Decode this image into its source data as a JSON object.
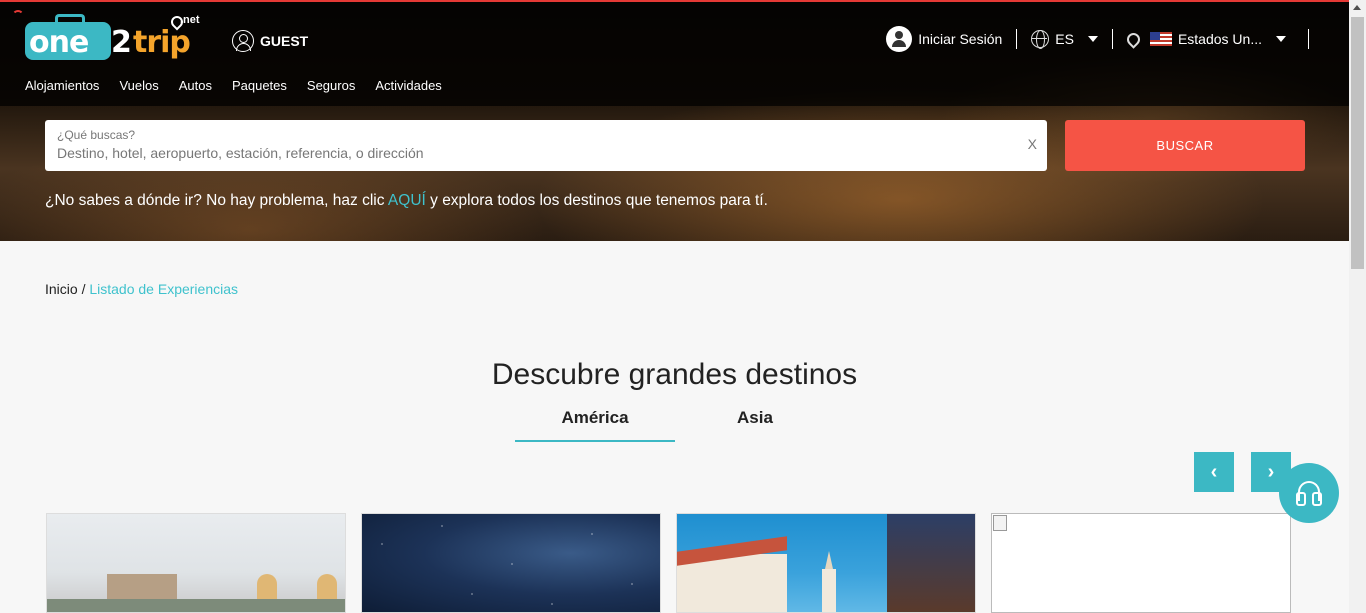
{
  "header": {
    "logo": {
      "one": "one",
      "two": "2",
      "trip": "trip",
      "net": ".net"
    },
    "guest_label": "GUEST",
    "login_label": "Iniciar Sesión",
    "language": "ES",
    "country": "Estados Un..."
  },
  "nav": {
    "items": [
      "Alojamientos",
      "Vuelos",
      "Autos",
      "Paquetes",
      "Seguros",
      "Actividades"
    ]
  },
  "search": {
    "label": "¿Qué buscas?",
    "placeholder": "Destino, hotel, aeropuerto, estación, referencia, o dirección",
    "value": "",
    "clear": "X",
    "button": "BUSCAR"
  },
  "hint": {
    "before": "¿No sabes a dónde ir? No hay problema, haz clic ",
    "link": "AQUÍ",
    "after": " y explora todos los destinos que tenemos para tí."
  },
  "breadcrumb": {
    "home": "Inicio",
    "separator": " / ",
    "current": "Listado de Experiencias"
  },
  "destinations": {
    "title": "Descubre grandes destinos",
    "tabs": [
      {
        "label": "América",
        "active": true
      },
      {
        "label": "Asia",
        "active": false
      }
    ],
    "prev": "‹",
    "next": "›"
  },
  "icons": {
    "user": "user-icon",
    "login": "account-icon",
    "language": "globe-icon",
    "country": "location-pin-icon",
    "flag": "us-flag-icon",
    "help": "headset-icon"
  },
  "colors": {
    "accent": "#3cb8c4",
    "cta": "#f55445",
    "top_line": "#e53935"
  }
}
